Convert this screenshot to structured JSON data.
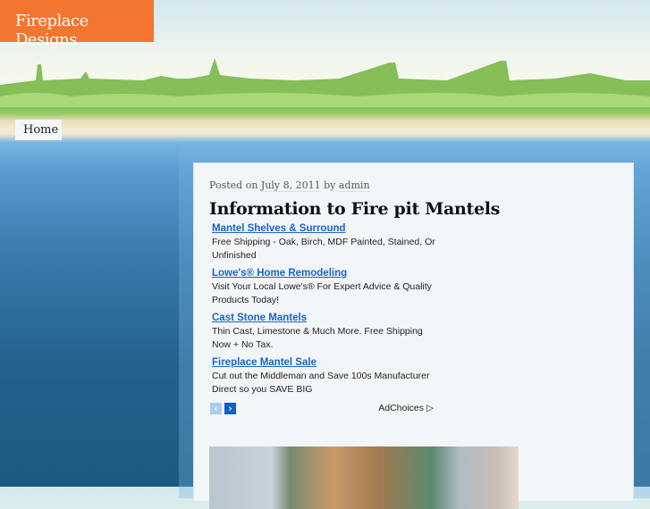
{
  "site": {
    "title": "Fireplace Designs",
    "nav": [
      "Home"
    ]
  },
  "post": {
    "posted_on": "Posted on",
    "date": "July 8, 2011",
    "by": "by",
    "author": "admin",
    "title": "Information to Fire pit Mantels"
  },
  "ads": [
    {
      "title": "Mantel Shelves & Surround",
      "text": "Free Shipping - Oak, Birch, MDF Painted, Stained, Or Unfinished"
    },
    {
      "title": "Lowe's® Home Remodeling",
      "text": "Visit Your Local Lowe's® For Expert Advice & Quality Products Today!"
    },
    {
      "title": "Cast Stone Mantels",
      "text": "Thin Cast, Limestone & Much More. Free Shipping Now + No Tax."
    },
    {
      "title": "Fireplace Mantel Sale",
      "text": "Cut out the Middleman and Save 100s Manufacturer Direct so you SAVE BIG"
    }
  ],
  "ad_footer": {
    "adchoices": "AdChoices",
    "prev": "‹",
    "next": "›"
  },
  "colors": {
    "logo_bg": "#f47530",
    "ad_link": "#1a63c8"
  }
}
